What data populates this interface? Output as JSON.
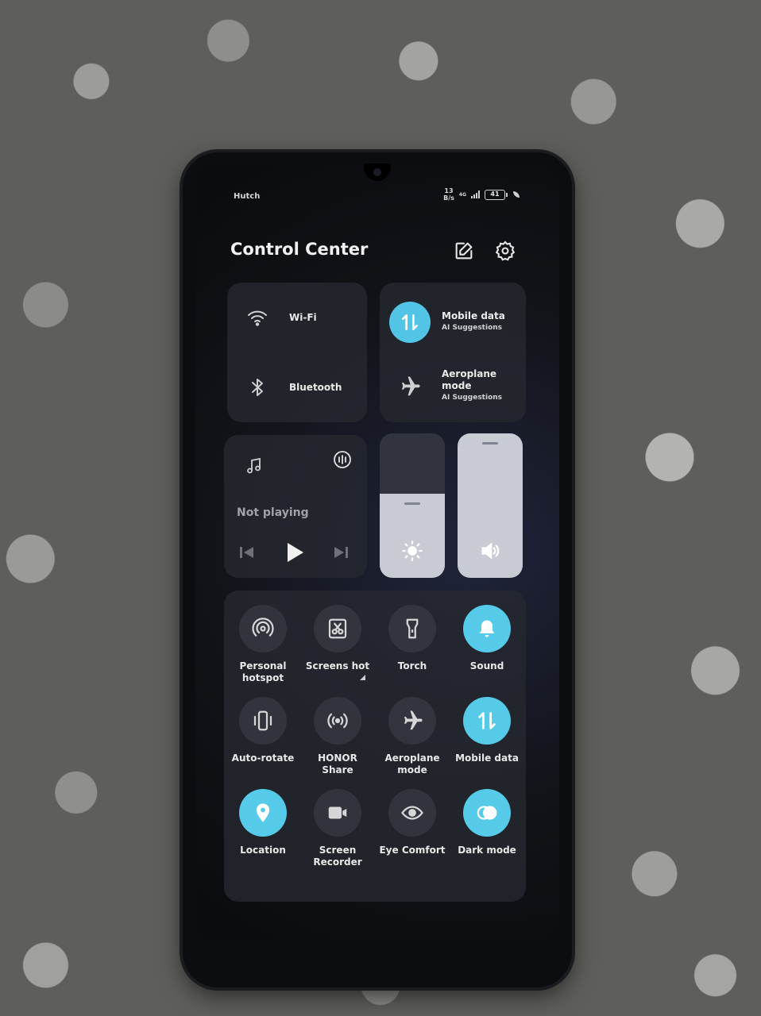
{
  "status_bar": {
    "carrier": "Hutch",
    "net_speed_value": "13",
    "net_speed_unit": "B/s",
    "network_type": "4G",
    "battery_level": "41"
  },
  "header": {
    "title": "Control Center",
    "edit_icon": "edit-icon",
    "settings_icon": "gear-icon"
  },
  "connectivity": [
    {
      "label": "Wi-Fi",
      "sub": "",
      "icon": "wifi-icon",
      "active": false
    },
    {
      "label": "Bluetooth",
      "sub": "",
      "icon": "bluetooth-icon",
      "active": false
    },
    {
      "label": "Mobile data",
      "sub": "AI Suggestions",
      "icon": "mobile-data-icon",
      "active": true
    },
    {
      "label": "Aeroplane mode",
      "sub": "AI Suggestions",
      "icon": "airplane-icon",
      "active": false
    }
  ],
  "media": {
    "status": "Not playing",
    "icons": [
      "music-note-icon",
      "audio-output-icon",
      "previous-icon",
      "play-icon",
      "next-icon"
    ]
  },
  "sliders": {
    "brightness_level": 0.58,
    "volume_level": 1.0,
    "accent_color": "#55cbe9"
  },
  "tiles": [
    {
      "label": "Personal hotspot",
      "icon": "hotspot-icon",
      "active": false
    },
    {
      "label": "Screens hot",
      "icon": "screenshot-icon",
      "active": false
    },
    {
      "label": "Torch",
      "icon": "torch-icon",
      "active": false
    },
    {
      "label": "Sound",
      "icon": "bell-icon",
      "active": true
    },
    {
      "label": "Auto-rotate",
      "icon": "auto-rotate-icon",
      "active": false
    },
    {
      "label": "HONOR Share",
      "icon": "honor-share-icon",
      "active": false
    },
    {
      "label": "Aeroplane mode",
      "icon": "airplane-icon",
      "active": false
    },
    {
      "label": "Mobile data",
      "icon": "mobile-data-icon",
      "active": true
    },
    {
      "label": "Location",
      "icon": "location-icon",
      "active": true
    },
    {
      "label": "Screen Recorder",
      "icon": "screen-recorder-icon",
      "active": false
    },
    {
      "label": "Eye Comfort",
      "icon": "eye-icon",
      "active": false
    },
    {
      "label": "Dark mode",
      "icon": "dark-mode-icon",
      "active": true
    }
  ]
}
